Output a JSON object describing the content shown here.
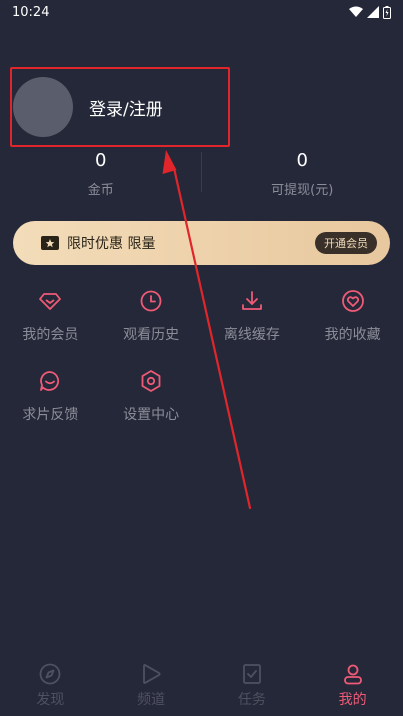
{
  "status_bar": {
    "time": "10:24"
  },
  "profile": {
    "login_label": "登录/注册"
  },
  "stats": [
    {
      "value": "0",
      "label": "金币"
    },
    {
      "value": "0",
      "label": "可提现(元)"
    }
  ],
  "vip_banner": {
    "text": "限时优惠 限量",
    "button_label": "开通会员"
  },
  "menu_items": [
    {
      "label": "我的会员",
      "icon": "diamond-icon"
    },
    {
      "label": "观看历史",
      "icon": "clock-icon"
    },
    {
      "label": "离线缓存",
      "icon": "download-icon"
    },
    {
      "label": "我的收藏",
      "icon": "heart-icon"
    },
    {
      "label": "求片反馈",
      "icon": "chat-icon"
    },
    {
      "label": "设置中心",
      "icon": "settings-icon"
    }
  ],
  "bottom_nav": [
    {
      "label": "发现",
      "icon": "compass-icon",
      "active": false
    },
    {
      "label": "频道",
      "icon": "play-icon",
      "active": false
    },
    {
      "label": "任务",
      "icon": "task-icon",
      "active": false
    },
    {
      "label": "我的",
      "icon": "user-icon",
      "active": true
    }
  ],
  "colors": {
    "background": "#252838",
    "accent": "#ef5a77",
    "annotation": "#e0262b",
    "vip_gold": "#f3dcb9"
  }
}
